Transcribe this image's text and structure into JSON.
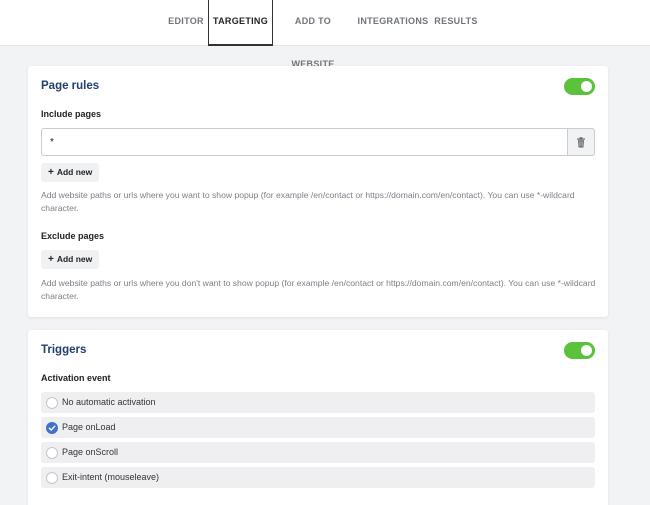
{
  "tabs": [
    {
      "label": "EDITOR"
    },
    {
      "label": "TARGETING"
    },
    {
      "label": "ADD TO WEBSITE"
    },
    {
      "label": "INTEGRATIONS"
    },
    {
      "label": "RESULTS"
    }
  ],
  "active_tab": "TARGETING",
  "page_rules": {
    "title": "Page rules",
    "enabled": true,
    "include": {
      "label": "Include pages",
      "value": "*",
      "add_label": "Add new",
      "help": "Add website paths or urls where you want to show popup (for example /en/contact or https://domain.com/en/contact). You can use *-wildcard character."
    },
    "exclude": {
      "label": "Exclude pages",
      "add_label": "Add new",
      "help": "Add website paths or urls where you don't want to show popup (for example /en/contact or https://domain.com/en/contact). You can use *-wildcard character."
    }
  },
  "triggers": {
    "title": "Triggers",
    "enabled": true,
    "activation_label": "Activation event",
    "options": [
      {
        "label": "No automatic activation",
        "checked": false
      },
      {
        "label": "Page onLoad",
        "checked": true
      },
      {
        "label": "Page onScroll",
        "checked": false
      },
      {
        "label": "Exit-intent (mouseleave)",
        "checked": false
      }
    ]
  },
  "colors": {
    "accent_green": "#5bc23c",
    "radio_blue": "#3f74c6",
    "title_navy": "#1f3f6e"
  },
  "icons": {
    "trash": "trash-icon",
    "plus": "plus-icon",
    "check": "check-icon"
  }
}
